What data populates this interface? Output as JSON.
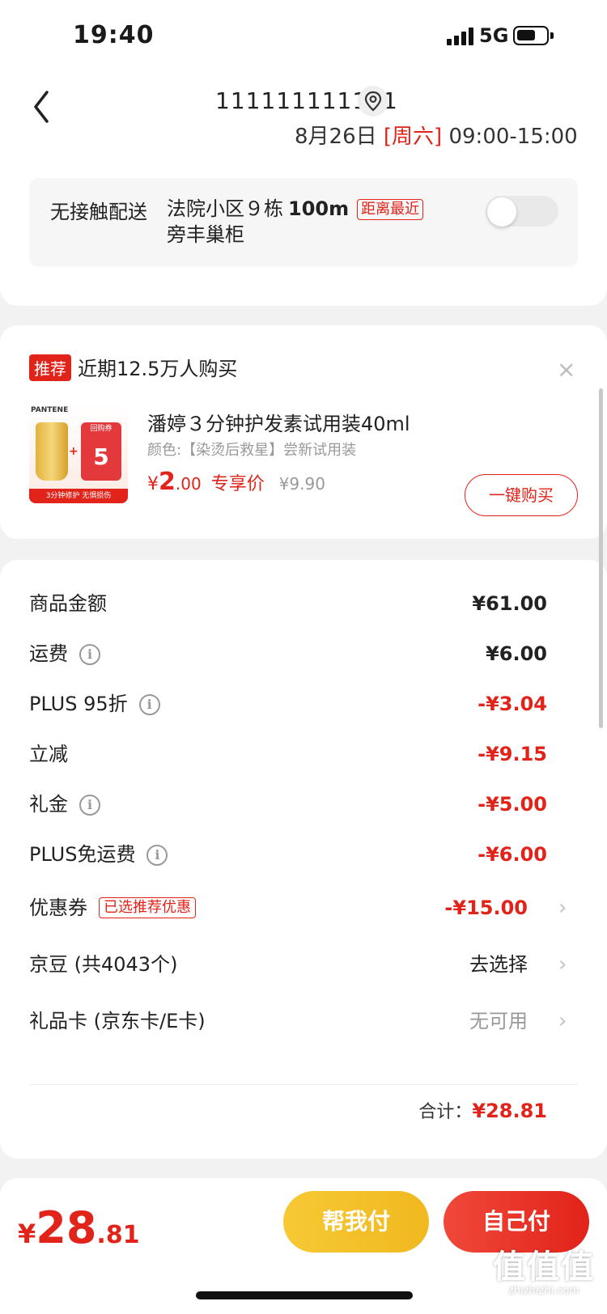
{
  "status_bar": {
    "time": "19:40",
    "network": "5G"
  },
  "nav": {
    "title": "111111111111"
  },
  "delivery": {
    "date_text": "8月26日",
    "date_weekday": "[周六]",
    "date_time": "09:00-15:00",
    "mode_label": "无接触配送",
    "address_line1": "法院小区９栋",
    "distance": "100m",
    "nearest_tag": "距离最近",
    "address_line2": "旁丰巢柜"
  },
  "recommend": {
    "tag": "推荐",
    "headline": "近期12.5万人购买",
    "close": "×",
    "product": {
      "thumb_brand": "PANTENE",
      "thumb_coupon_title": "回购券",
      "thumb_coupon_value": "5",
      "thumb_banner": "3分钟修护 无惧损伤",
      "title": "潘婷３分钟护发素试用装40ml",
      "spec": "颜色:【染烫后救星】尝新试用装",
      "price_symbol": "¥",
      "price_int": "2",
      "price_dec": ".00",
      "price_label": "专享价",
      "original_price": "¥9.90",
      "buy_label": "一键购买"
    }
  },
  "summary": {
    "rows": [
      {
        "label": "商品金额",
        "value": "¥61.00"
      },
      {
        "label": "运费",
        "value": "¥6.00"
      },
      {
        "label": "PLUS 95折",
        "value": "-¥3.04"
      },
      {
        "label": "立减",
        "value": "-¥9.15"
      },
      {
        "label": "礼金",
        "value": "-¥5.00"
      },
      {
        "label": "PLUS免运费",
        "value": "-¥6.00"
      },
      {
        "label": "优惠券",
        "tag": "已选推荐优惠",
        "value": "-¥15.00"
      },
      {
        "label": "京豆 (共4043个)",
        "value": "去选择"
      },
      {
        "label": "礼品卡 (京东卡/E卡)",
        "value": "无可用"
      }
    ],
    "total_label": "合计：",
    "total_value": "¥28.81"
  },
  "bottom": {
    "price_symbol": "¥",
    "price_int": "28",
    "price_dec": ".81",
    "help_pay": "帮我付",
    "self_pay": "自己付"
  },
  "watermark": {
    "main": "值值值",
    "sub": "zhizhizhi.com"
  },
  "colors": {
    "accent": "#e2231a",
    "help_button": "#f4c22b",
    "background": "#f2f2f2"
  },
  "icons": [
    "back-chevron-icon",
    "location-pin-icon",
    "info-icon",
    "chevron-right-icon",
    "close-icon"
  ]
}
